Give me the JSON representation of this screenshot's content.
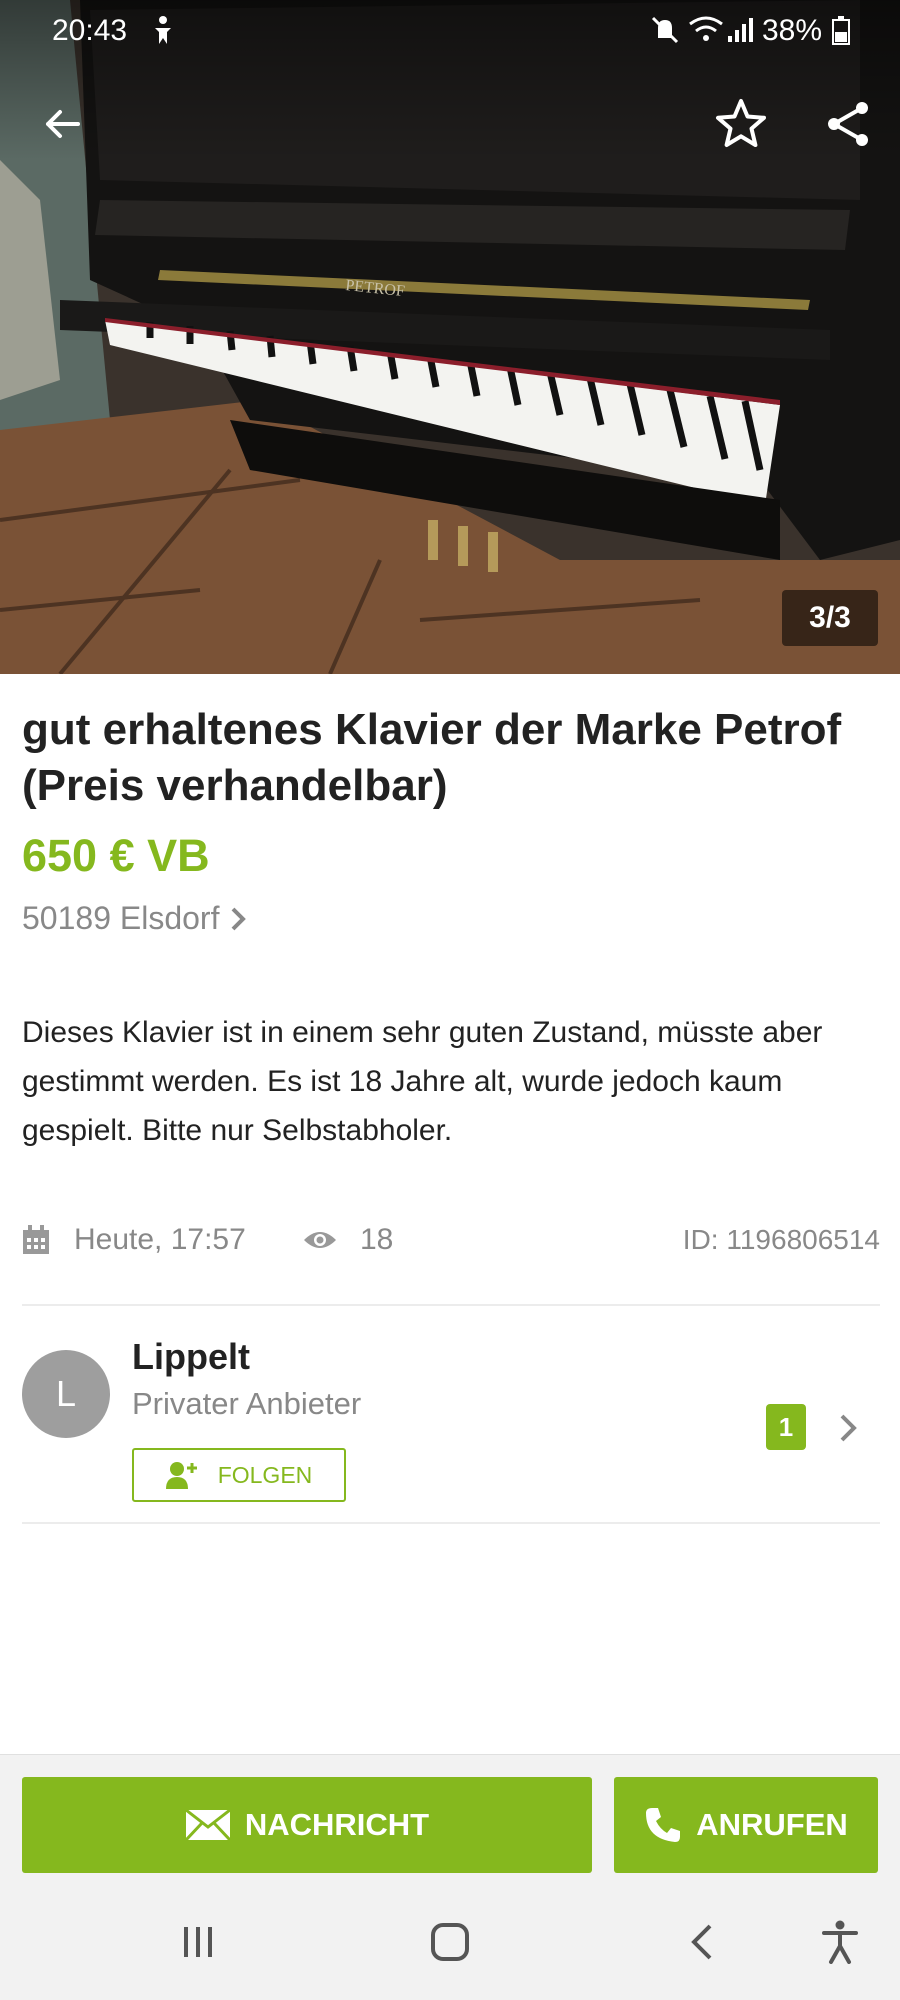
{
  "status_bar": {
    "time": "20:43",
    "battery": "38%",
    "icons": [
      "accessibility-icon",
      "mute-icon",
      "wifi-icon",
      "signal-icon",
      "battery-icon"
    ]
  },
  "top_bar": {
    "icons": [
      "back-arrow-icon",
      "star-outline-icon",
      "share-icon"
    ]
  },
  "gallery": {
    "counter": "3/3",
    "brand_on_piano": "PETROF"
  },
  "listing": {
    "title": "gut erhaltenes Klavier der Marke Petrof (Preis verhandelbar)",
    "price": "650 € VB",
    "location": "50189 Elsdorf",
    "description": "Dieses Klavier ist in einem sehr guten Zustand, müsste aber gestimmt werden. Es ist 18 Jahre alt, wurde jedoch kaum gespielt. Bitte nur Selbstabholer.",
    "date": "Heute, 17:57",
    "views": "18",
    "id": "ID: 1196806514"
  },
  "seller": {
    "initial": "L",
    "name": "Lippelt",
    "type": "Privater Anbieter",
    "follow_label": "FOLGEN",
    "ads_count": "1"
  },
  "actions": {
    "message_label": "NACHRICHT",
    "call_label": "ANRUFEN"
  },
  "colors": {
    "accent": "#85b81e",
    "muted_text": "#888888"
  },
  "nav_bar": {
    "icons": [
      "recents-icon",
      "home-icon",
      "back-icon",
      "accessibility-icon"
    ]
  }
}
